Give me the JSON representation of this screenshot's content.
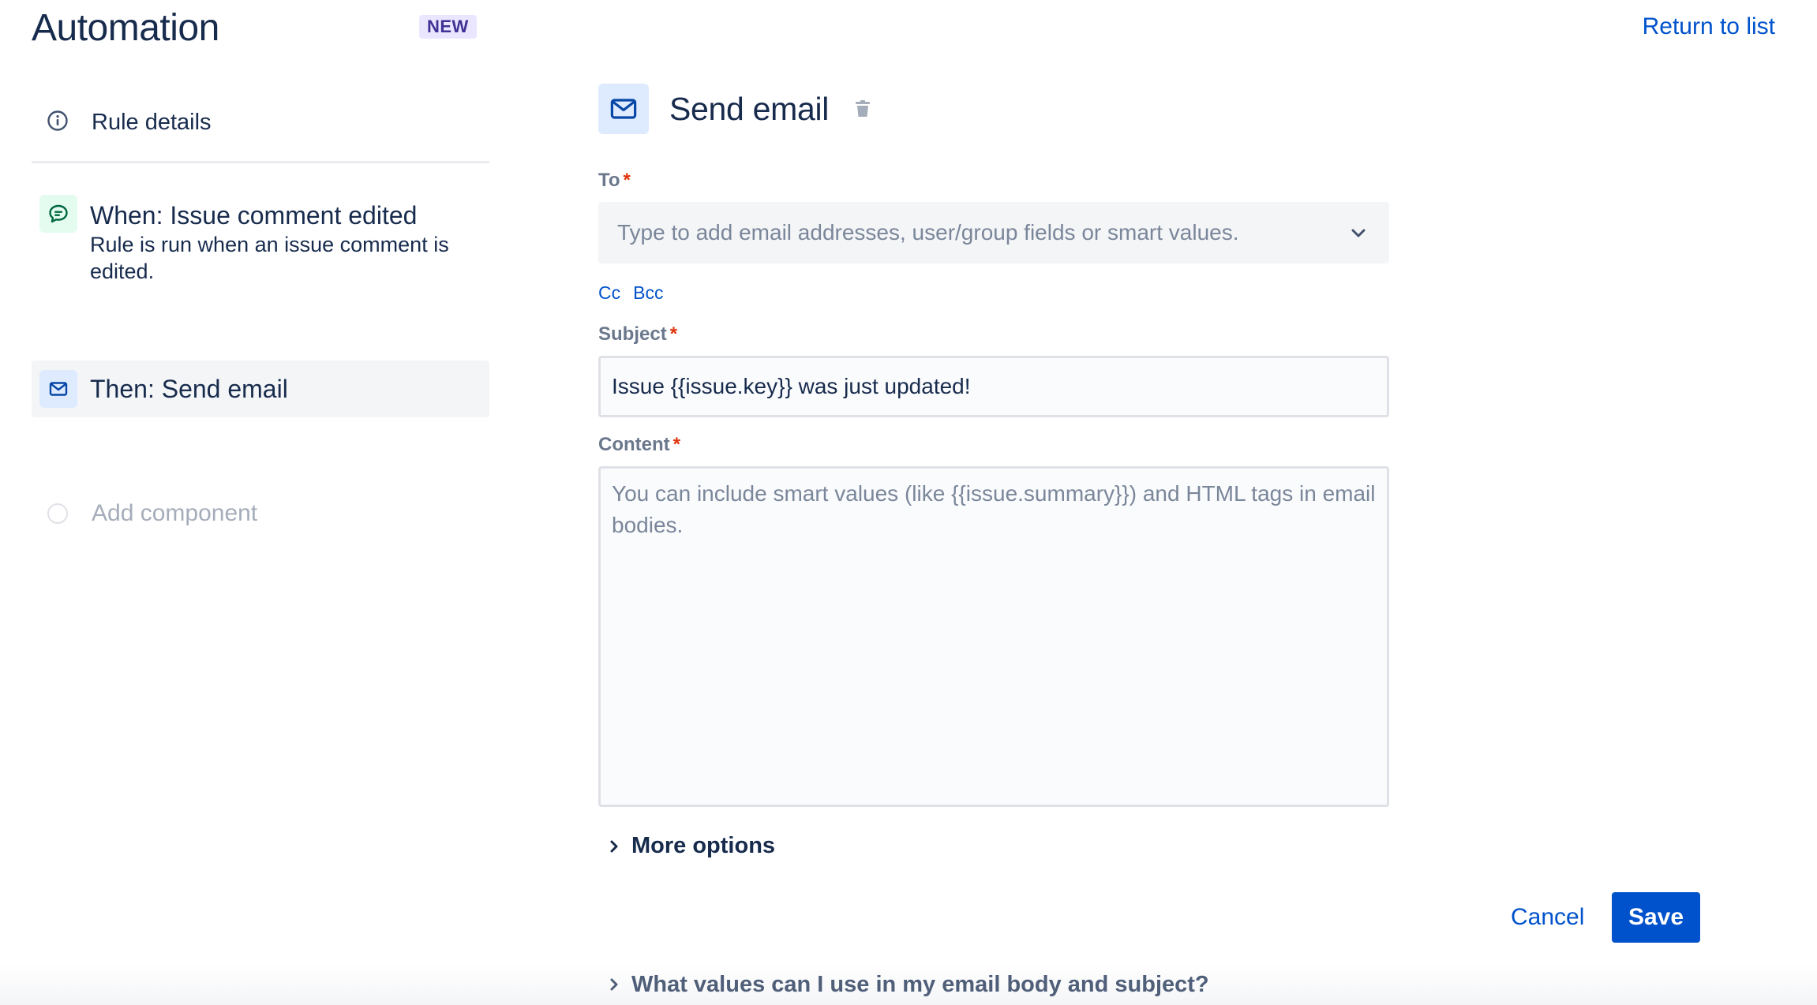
{
  "header": {
    "title": "Automation",
    "badge": "NEW",
    "return_link": "Return to list"
  },
  "sidebar": {
    "rule_details": {
      "icon": "info-icon",
      "label": "Rule details"
    },
    "trigger": {
      "icon": "comment-icon",
      "title": "When: Issue comment edited",
      "description": "Rule is run when an issue comment is edited."
    },
    "action": {
      "icon": "envelope-icon",
      "title": "Then: Send email"
    },
    "add_component": {
      "label": "Add component"
    }
  },
  "main": {
    "header": {
      "icon": "envelope-icon",
      "title": "Send email",
      "delete_icon": "trash-icon"
    },
    "to": {
      "label": "To",
      "required_mark": "*",
      "placeholder": "Type to add email addresses, user/group fields or smart values."
    },
    "cc_label": "Cc",
    "bcc_label": "Bcc",
    "subject": {
      "label": "Subject",
      "required_mark": "*",
      "value": "Issue {{issue.key}} was just updated!"
    },
    "content": {
      "label": "Content",
      "required_mark": "*",
      "placeholder": "You can include smart values (like {{issue.summary}}) and HTML tags in email bodies."
    },
    "more_options": "More options",
    "help": "What values can I use in my email body and subject?"
  },
  "buttons": {
    "cancel": "Cancel",
    "save": "Save"
  },
  "colors": {
    "brand": "#0052CC",
    "text": "#172B4D",
    "required": "#DE350B",
    "badge_bg": "#EAE6FF",
    "badge_text": "#403294",
    "trigger_bg": "#E3FCEF",
    "action_bg": "#DEEBFF"
  }
}
